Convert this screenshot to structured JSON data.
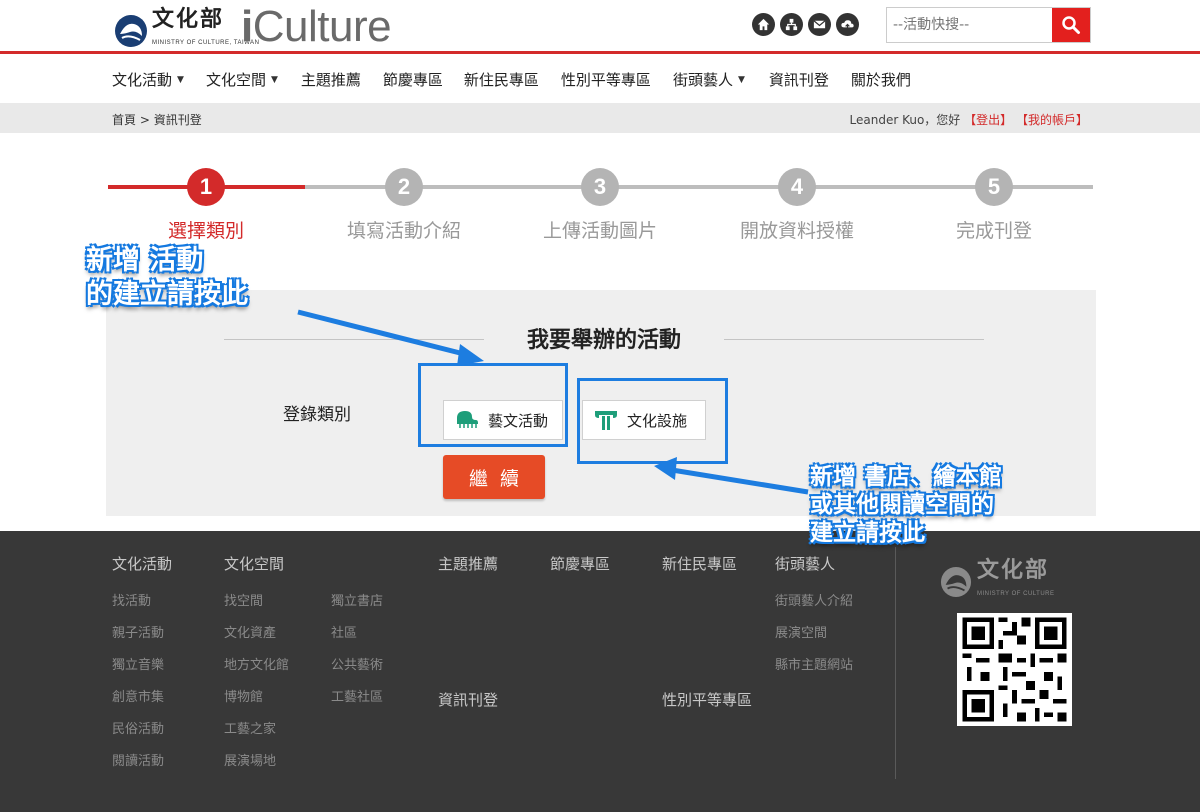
{
  "header": {
    "logo_text": "文化部",
    "logo_sub": "MINISTRY OF CULTURE, TAIWAN",
    "brand_i": "i",
    "brand_rest": "Culture",
    "quick_icons": [
      "home-icon",
      "sitemap-icon",
      "mail-icon",
      "upload-icon"
    ],
    "search_placeholder": "--活動快搜--"
  },
  "nav": {
    "items": [
      {
        "label": "文化活動",
        "dropdown": true
      },
      {
        "label": "文化空間",
        "dropdown": true
      },
      {
        "label": "主題推薦",
        "dropdown": false
      },
      {
        "label": "節慶專區",
        "dropdown": false
      },
      {
        "label": "新住民專區",
        "dropdown": false
      },
      {
        "label": "性別平等專區",
        "dropdown": false
      },
      {
        "label": "街頭藝人",
        "dropdown": true
      },
      {
        "label": "資訊刊登",
        "dropdown": false
      },
      {
        "label": "關於我們",
        "dropdown": false
      }
    ],
    "caret": "▼"
  },
  "breadcrumb": {
    "home": "首頁",
    "sep": ">",
    "current": "資訊刊登"
  },
  "user": {
    "greeting": "Leander Kuo，您好",
    "logout": "【登出】",
    "account": "【我的帳戶】"
  },
  "steps": [
    {
      "num": "1",
      "label": "選擇類別",
      "active": true
    },
    {
      "num": "2",
      "label": "填寫活動介紹",
      "active": false
    },
    {
      "num": "3",
      "label": "上傳活動圖片",
      "active": false
    },
    {
      "num": "4",
      "label": "開放資料授權",
      "active": false
    },
    {
      "num": "5",
      "label": "完成刊登",
      "active": false
    }
  ],
  "panel": {
    "title": "我要舉辦的活動",
    "category_label": "登錄類別",
    "options": [
      {
        "label": "藝文活動",
        "icon": "piano-icon"
      },
      {
        "label": "文化設施",
        "icon": "pillar-icon"
      }
    ],
    "continue": "繼續"
  },
  "annotations": {
    "arts_line1": "新增 活動",
    "arts_line2": "的建立請按此",
    "facility_line1": "新增 書店、繪本館",
    "facility_line2": "或其他閱讀空間的",
    "facility_line3": "建立請按此",
    "color": "#1d7de0"
  },
  "footer": {
    "col1": {
      "head": "文化活動",
      "links": [
        "找活動",
        "親子活動",
        "獨立音樂",
        "創意市集",
        "民俗活動",
        "閱讀活動"
      ]
    },
    "col2": {
      "head": "文化空間",
      "links": [
        "找空間",
        "文化資產",
        "地方文化館",
        "博物館",
        "工藝之家",
        "展演場地"
      ]
    },
    "col3": {
      "links": [
        "獨立書店",
        "社區",
        "公共藝術",
        "工藝社區"
      ]
    },
    "col4": {
      "head": "主題推薦"
    },
    "col5": {
      "head": "節慶專區"
    },
    "col6": {
      "head": "新住民專區"
    },
    "col7": {
      "head": "街頭藝人",
      "links": [
        "街頭藝人介紹",
        "展演空間",
        "縣市主題網站"
      ]
    },
    "col8": {
      "head": "資訊刊登"
    },
    "col9": {
      "head": "性別平等專區"
    },
    "logo_text": "文化部",
    "logo_sub": "MINISTRY OF CULTURE"
  },
  "colors": {
    "accent_red": "#d32a2a",
    "button_orange": "#e64b26",
    "footer_bg": "#383838"
  }
}
